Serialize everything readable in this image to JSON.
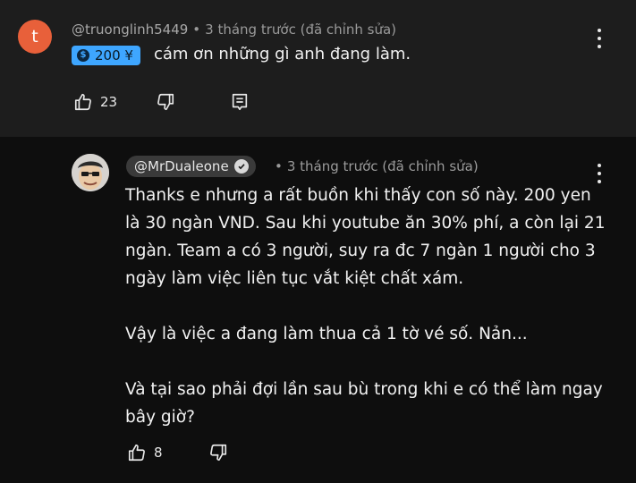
{
  "comment": {
    "avatar_letter": "t",
    "username": "@truonglinh5449",
    "separator": "•",
    "time": "3 tháng trước (đã chỉnh sửa)",
    "thanks_amount": "200 ¥",
    "text": "cám ơn những gì anh đang làm.",
    "like_count": "23"
  },
  "reply": {
    "channel": "@MrDualeone",
    "separator": "•",
    "time": "3 tháng trước (đã chỉnh sửa)",
    "paragraphs": [
      "Thanks e nhưng a rất buồn khi thấy con số này. 200 yen là 30 ngàn VND. Sau khi youtube ăn 30% phí, a còn lại 21 ngàn. Team a có 3 người, suy ra đc 7 ngàn 1 người cho 3 ngày làm việc liên tục vắt kiệt chất xám.",
      "Vậy là việc a đang làm thua cả 1 tờ vé số. Nản...",
      "Và tại sao phải đợi lần sau bù trong khi e có thể làm ngay bây giờ?"
    ],
    "like_count": "8"
  },
  "colors": {
    "avatar_bg": "#e8603a",
    "thanks_chip": "#3ea6ff",
    "top_panel": "#1d1d1d",
    "background": "#0e0e0e"
  },
  "icons": [
    "like-icon",
    "dislike-icon",
    "reply-icon",
    "more-vert-icon",
    "verified-check-icon",
    "coin-icon"
  ]
}
